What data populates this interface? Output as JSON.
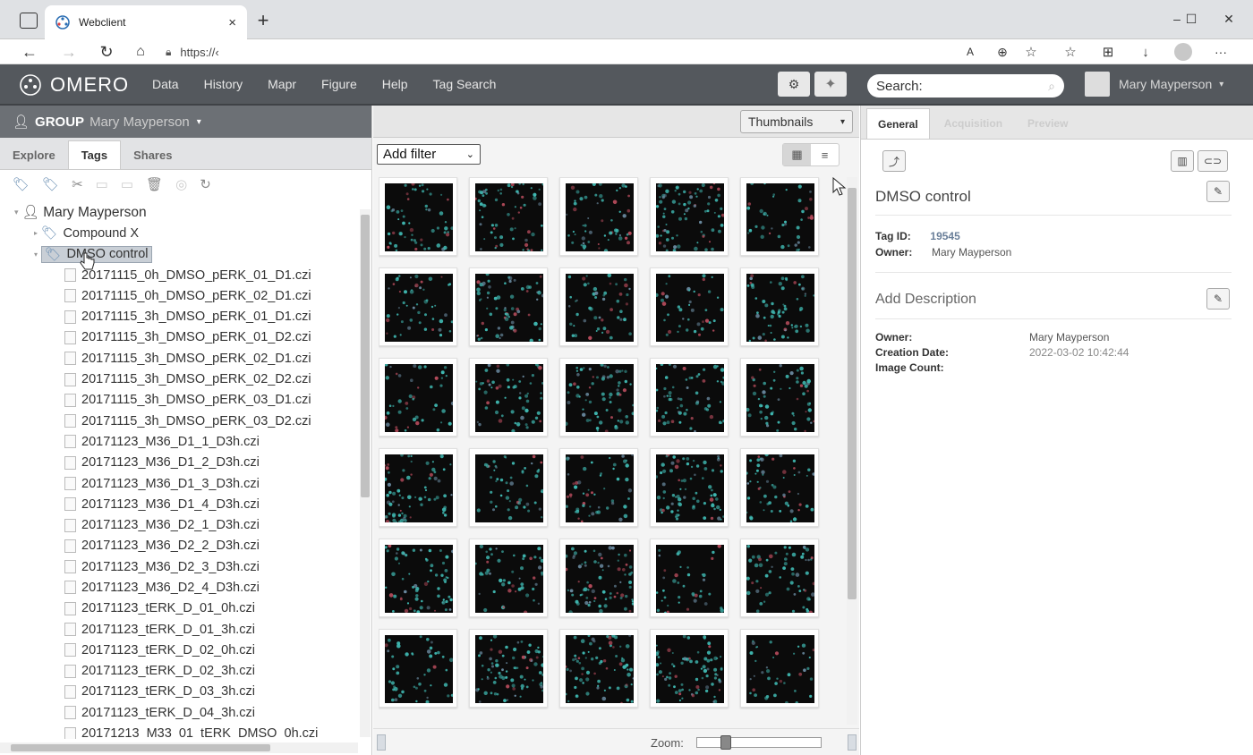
{
  "browser": {
    "tab_title": "Webclient",
    "tab_close": "×",
    "new_tab": "+",
    "url": "https://‹",
    "min": "–",
    "max": "☐",
    "close": "✕"
  },
  "omero": {
    "logo_text": "OMERO",
    "nav": [
      "Data",
      "History",
      "Mapr",
      "Figure",
      "Help",
      "Tag Search"
    ],
    "search_placeholder": "Search:",
    "user": "Mary Mayperson"
  },
  "left": {
    "group_label": "GROUP",
    "group_user": "Mary Mayperson",
    "tabs": [
      "Explore",
      "Tags",
      "Shares"
    ],
    "tree_root": "Mary Mayperson",
    "tags": [
      "Compound X",
      "DMSO control"
    ],
    "files": [
      "20171115_0h_DMSO_pERK_01_D1.czi",
      "20171115_0h_DMSO_pERK_02_D1.czi",
      "20171115_3h_DMSO_pERK_01_D1.czi",
      "20171115_3h_DMSO_pERK_01_D2.czi",
      "20171115_3h_DMSO_pERK_02_D1.czi",
      "20171115_3h_DMSO_pERK_02_D2.czi",
      "20171115_3h_DMSO_pERK_03_D1.czi",
      "20171115_3h_DMSO_pERK_03_D2.czi",
      "20171123_M36_D1_1_D3h.czi",
      "20171123_M36_D1_2_D3h.czi",
      "20171123_M36_D1_3_D3h.czi",
      "20171123_M36_D1_4_D3h.czi",
      "20171123_M36_D2_1_D3h.czi",
      "20171123_M36_D2_2_D3h.czi",
      "20171123_M36_D2_3_D3h.czi",
      "20171123_M36_D2_4_D3h.czi",
      "20171123_tERK_D_01_0h.czi",
      "20171123_tERK_D_01_3h.czi",
      "20171123_tERK_D_02_0h.czi",
      "20171123_tERK_D_02_3h.czi",
      "20171123_tERK_D_03_3h.czi",
      "20171123_tERK_D_04_3h.czi",
      "20171213_M33_01_tERK_DMSO_0h.czi"
    ]
  },
  "center": {
    "view_mode": "Thumbnails",
    "filter": "Add filter",
    "zoom_label": "Zoom:",
    "zoom_level": 0.2,
    "thumb_rows": 6,
    "thumb_cols": 5
  },
  "right": {
    "tabs": [
      "General",
      "Acquisition",
      "Preview"
    ],
    "title": "DMSO control",
    "tag_id_label": "Tag ID:",
    "tag_id": "19545",
    "owner_label": "Owner:",
    "owner": "Mary Mayperson",
    "add_description": "Add Description",
    "owner2_label": "Owner:",
    "owner2": "Mary Mayperson",
    "creation_label": "Creation Date:",
    "creation": "2022-03-02 10:42:44",
    "image_count_label": "Image Count:"
  }
}
